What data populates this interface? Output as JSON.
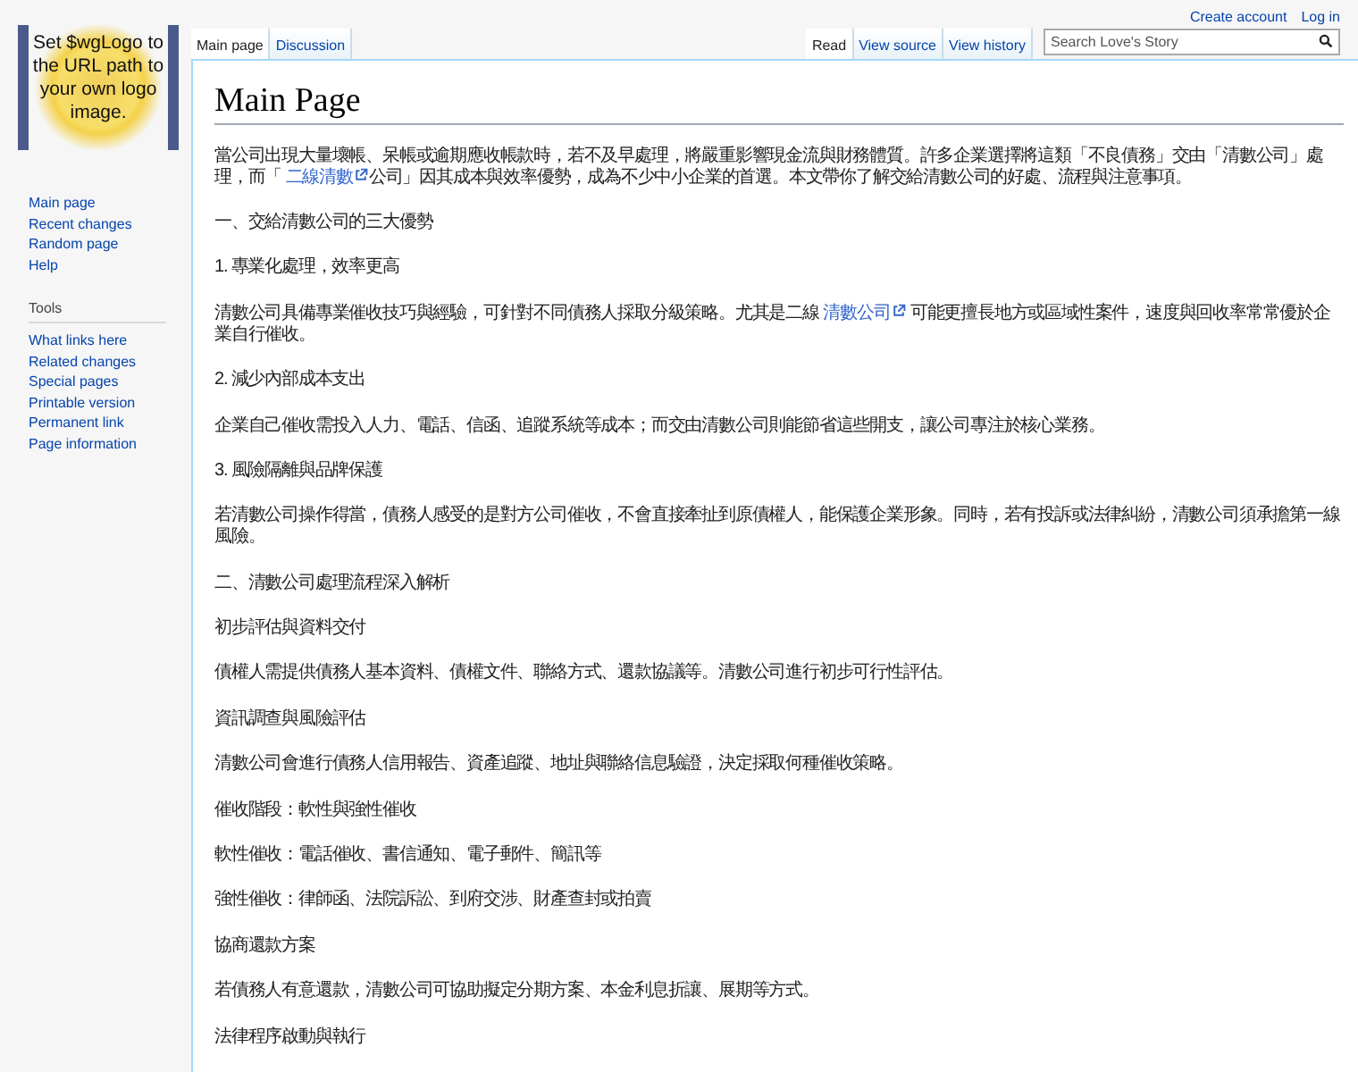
{
  "logo": {
    "text": "Set $wgLogo to the URL path to your own logo image."
  },
  "personal_links": [
    "Create account",
    "Log in"
  ],
  "left_tabs": [
    {
      "label": "Main page",
      "selected": true
    },
    {
      "label": "Discussion",
      "selected": false
    }
  ],
  "right_tabs": [
    {
      "label": "Read",
      "selected": true
    },
    {
      "label": "View source",
      "selected": false
    },
    {
      "label": "View history",
      "selected": false
    }
  ],
  "search": {
    "placeholder": "Search Love's Story"
  },
  "sidebar": {
    "navigation": [
      "Main page",
      "Recent changes",
      "Random page",
      "Help"
    ],
    "tools": {
      "heading": "Tools",
      "items": [
        "What links here",
        "Related changes",
        "Special pages",
        "Printable version",
        "Permanent link",
        "Page information"
      ]
    }
  },
  "page": {
    "title": "Main Page",
    "paragraphs": [
      {
        "segments": [
          {
            "kind": "text",
            "text": "當公司出現大量壞帳、呆帳或逾期應收帳款時，若不及早處理，將嚴重影響現金流與財務體質。許多企業選擇將這類「不良債務」交由「清數公司」處理，而「 "
          },
          {
            "kind": "link",
            "text": "二線清數"
          },
          {
            "kind": "text",
            "text": "公司」因其成本與效率優勢，成為不少中小企業的首選。本文帶你了解交給清數公司的好處、流程與注意事項。"
          }
        ]
      },
      {
        "text": "一、交給清數公司的三大優勢"
      },
      {
        "text": "1. 專業化處理，效率更高"
      },
      {
        "segments": [
          {
            "kind": "text",
            "text": "清數公司具備專業催收技巧與經驗，可針對不同債務人採取分級策略。尤其是二線 "
          },
          {
            "kind": "link",
            "text": "清數公司"
          },
          {
            "kind": "text",
            "text": " 可能更擅長地方或區域性案件，速度與回收率常常優於企業自行催收。"
          }
        ]
      },
      {
        "text": "2. 減少內部成本支出"
      },
      {
        "text": "企業自己催收需投入人力、電話、信函、追蹤系統等成本；而交由清數公司則能節省這些開支，讓公司專注於核心業務。"
      },
      {
        "text": "3. 風險隔離與品牌保護"
      },
      {
        "text": "若清數公司操作得當，債務人感受的是對方公司催收，不會直接牽扯到原債權人，能保護企業形象。同時，若有投訴或法律糾紛，清數公司須承擔第一線風險。"
      },
      {
        "text": "二、清數公司處理流程深入解析"
      },
      {
        "text": "初步評估與資料交付"
      },
      {
        "text": "債權人需提供債務人基本資料、債權文件、聯絡方式、還款協議等。清數公司進行初步可行性評估。"
      },
      {
        "text": "資訊調查與風險評估"
      },
      {
        "text": "清數公司會進行債務人信用報告、資產追蹤、地址與聯絡信息驗證，決定採取何種催收策略。"
      },
      {
        "text": "催收階段：軟性與強性催收"
      },
      {
        "text": "軟性催收：電話催收、書信通知、電子郵件、簡訊等"
      },
      {
        "text": "強性催收：律師函、法院訴訟、到府交涉、財產查封或拍賣"
      },
      {
        "text": "協商還款方案"
      },
      {
        "text": "若債務人有意還款，清數公司可協助擬定分期方案、本金利息折讓、展期等方式。"
      },
      {
        "text": "法律程序啟動與執行"
      }
    ]
  }
}
